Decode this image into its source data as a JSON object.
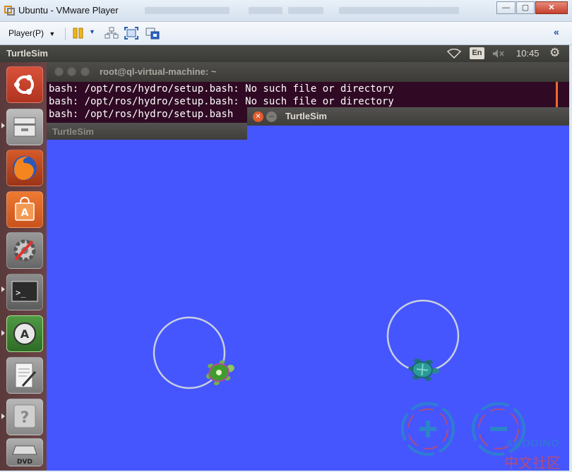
{
  "host_window": {
    "title": "Ubuntu - VMware Player",
    "controls": {
      "minimize": "—",
      "maximize": "▢",
      "close": "✕"
    }
  },
  "toolbar": {
    "player_menu": "Player(P)",
    "collapse_glyph": "«"
  },
  "ubuntu_panel": {
    "app_title": "TurtleSim",
    "language": "En",
    "clock": "10:45"
  },
  "launcher": {
    "items": [
      "ubuntu-dash",
      "files",
      "firefox",
      "software-center",
      "system-settings",
      "terminal",
      "software-updater",
      "text-editor",
      "help",
      "dvd"
    ]
  },
  "terminal": {
    "title": "root@ql-virtual-machine: ~",
    "lines": [
      "bash: /opt/ros/hydro/setup.bash: No such file or directory",
      "bash: /opt/ros/hydro/setup.bash: No such file or directory",
      "bash: /opt/ros/hydro/setup.bash"
    ]
  },
  "turtlesim_back": {
    "title": "TurtleSim"
  },
  "turtlesim_front": {
    "title": "TurtleSim"
  },
  "watermark": {
    "text_en": "ARDUINO",
    "text_cn": "中文社区"
  },
  "colors": {
    "sim_background": "#4556ff",
    "terminal_background": "#300a24",
    "ubuntu_close": "#e45c2d",
    "trail": "#c8cfe0"
  }
}
